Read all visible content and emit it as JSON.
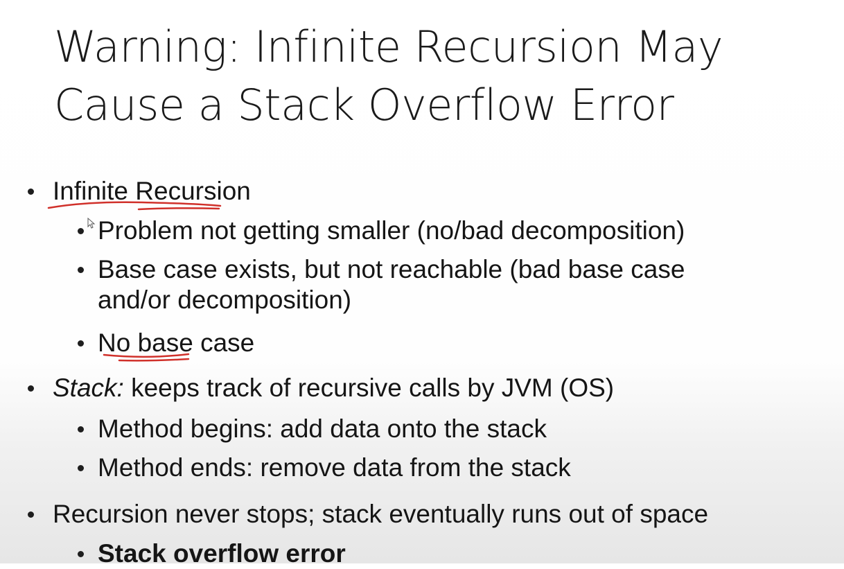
{
  "slide": {
    "title_line1": "Warning: Infinite Recursion May",
    "title_line2": "Cause a Stack Overflow Error",
    "bullets": [
      {
        "text": "Infinite Recursion"
      },
      {
        "text": "Problem not getting smaller (no/bad decomposition)"
      },
      {
        "text_line1": "Base case exists, but not reachable (bad base case",
        "text_line2": "and/or decomposition)"
      },
      {
        "text": "No base case"
      },
      {
        "term": "Stack:",
        "text": " keeps track of recursive calls by JVM (OS)"
      },
      {
        "text": "Method begins: add data onto the stack"
      },
      {
        "text": "Method ends: remove data from the stack"
      },
      {
        "text": "Recursion never stops; stack eventually runs out of space"
      },
      {
        "text": "Stack overflow error"
      }
    ]
  },
  "annotations": {
    "ink_color": "#d0302a"
  }
}
